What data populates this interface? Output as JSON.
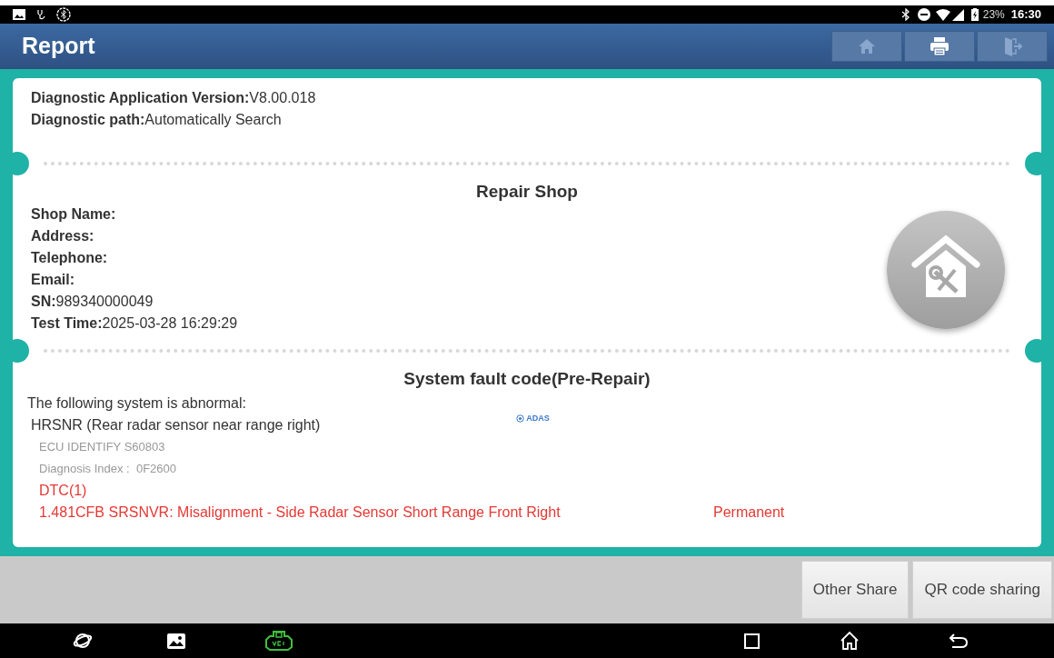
{
  "status_bar": {
    "battery": "23%",
    "time": "16:30"
  },
  "header": {
    "title": "Report"
  },
  "toolbar": [
    {
      "kind": "home",
      "disabled": true
    },
    {
      "kind": "print",
      "disabled": false
    },
    {
      "kind": "exit",
      "disabled": true
    }
  ],
  "info": [
    {
      "label": "Diagnostic Application Version:",
      "value": "V8.00.018"
    },
    {
      "label": "Diagnostic path:",
      "value": "Automatically Search"
    }
  ],
  "repair_shop": {
    "title": "Repair Shop",
    "fields": [
      {
        "label": "Shop Name:"
      },
      {
        "label": "Address:"
      },
      {
        "label": "Telephone:"
      },
      {
        "label": "Email:"
      },
      {
        "label": "SN:",
        "value": "989340000049"
      },
      {
        "label": "Test Time:",
        "value": "2025-03-28 16:29:29"
      }
    ]
  },
  "fault": {
    "title": "System fault code(Pre-Repair)",
    "intro": "The following system is abnormal:",
    "system": "HRSNR (Rear radar sensor near range right)",
    "tag": "ADAS",
    "ecu": "ECU IDENTIFY S60803",
    "index": "Diagnosis Index :  0F2600",
    "dtc_title": "DTC(1)",
    "dtcs": [
      {
        "code": "1.481CFB SRSNVR: Misalignment - Side Radar Sensor Short Range Front Right",
        "status": "Permanent"
      }
    ]
  },
  "buttons": [
    "Other Share",
    "QR code sharing"
  ]
}
